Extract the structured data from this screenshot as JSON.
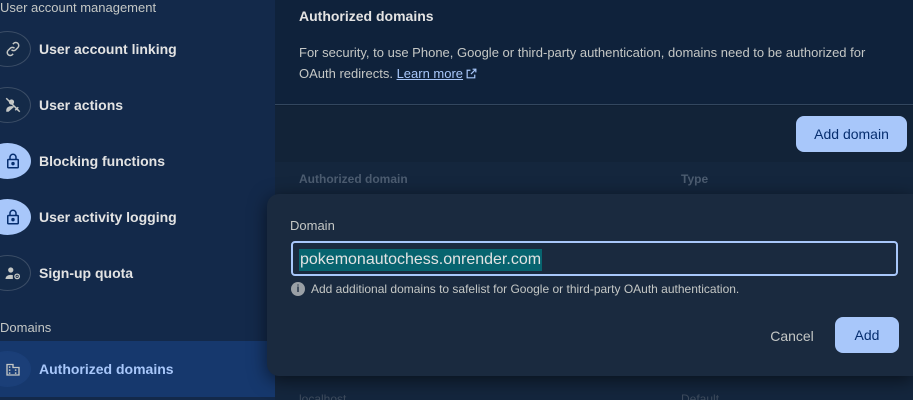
{
  "sidebar": {
    "section_user": "User account management",
    "items": [
      {
        "label": "User account linking",
        "icon": "link-icon"
      },
      {
        "label": "User actions",
        "icon": "person-off-icon"
      },
      {
        "label": "Blocking functions",
        "icon": "lock-icon"
      },
      {
        "label": "User activity logging",
        "icon": "lock-icon"
      },
      {
        "label": "Sign-up quota",
        "icon": "person-settings-icon"
      }
    ],
    "section_domains": "Domains",
    "domains_items": [
      {
        "label": "Authorized domains",
        "icon": "domain-icon",
        "active": true
      }
    ]
  },
  "card": {
    "title": "Authorized domains",
    "description": "For security, to use Phone, Google or third-party authentication, domains need to be authorized for OAuth redirects.",
    "learn_more": "Learn more"
  },
  "toolbar": {
    "add_domain_label": "Add domain"
  },
  "table": {
    "columns": [
      "Authorized domain",
      "Type"
    ],
    "partial_row": [
      "localhost",
      "Default"
    ]
  },
  "dialog": {
    "field_label": "Domain",
    "domain_value": "pokemonautochess.onrender.com",
    "hint": "Add additional domains to safelist for Google or third-party OAuth authentication.",
    "cancel_label": "Cancel",
    "add_label": "Add"
  },
  "colors": {
    "accent": "#a8c7fa",
    "sidebar_bg": "#13294a",
    "active_bg": "#16386d",
    "dialog_bg": "#1a2a3f"
  }
}
